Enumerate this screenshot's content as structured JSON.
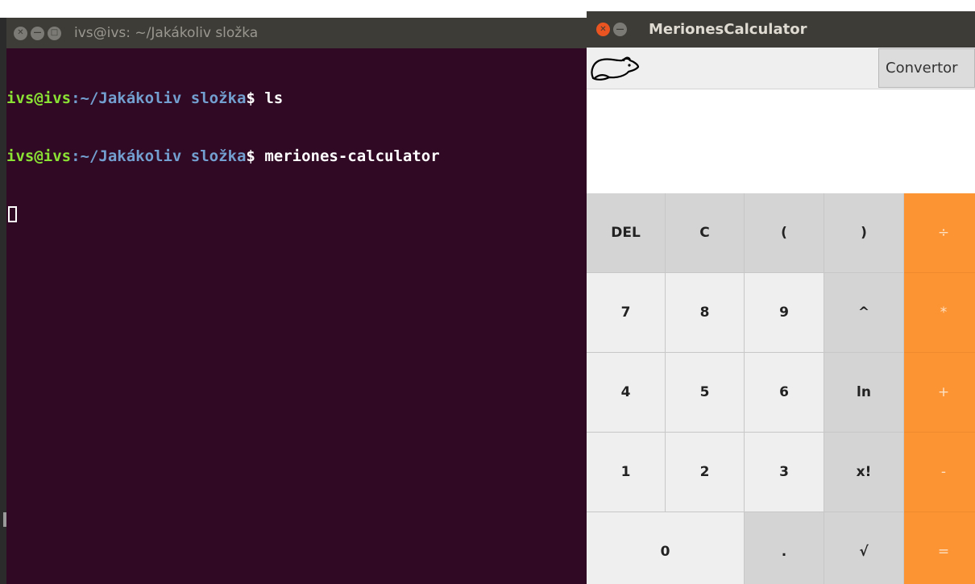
{
  "terminal": {
    "title": "ivs@ivs: ~/Jakákoliv složka",
    "lines": [
      {
        "user": "ivs@ivs",
        "path": ":~/Jakákoliv složka",
        "prompt": "$",
        "cmd": " ls"
      },
      {
        "user": "ivs@ivs",
        "path": ":~/Jakákoliv složka",
        "prompt": "$",
        "cmd": " meriones-calculator"
      }
    ]
  },
  "calculator": {
    "title": "MerionesCalculator",
    "convertor_label": "Convertor",
    "display_value": "",
    "keys": {
      "row1": [
        "DEL",
        "C",
        "(",
        ")",
        "÷"
      ],
      "row2": [
        "7",
        "8",
        "9",
        "^",
        "*"
      ],
      "row3": [
        "4",
        "5",
        "6",
        "ln",
        "+"
      ],
      "row4": [
        "1",
        "2",
        "3",
        "x!",
        "-"
      ],
      "row5": [
        "0",
        ".",
        "√",
        "="
      ]
    }
  },
  "colors": {
    "terminal_bg": "#300a24",
    "prompt_user": "#8ae234",
    "prompt_path": "#729fcf",
    "operator_key": "#fd9433",
    "close_button": "#e95420"
  }
}
